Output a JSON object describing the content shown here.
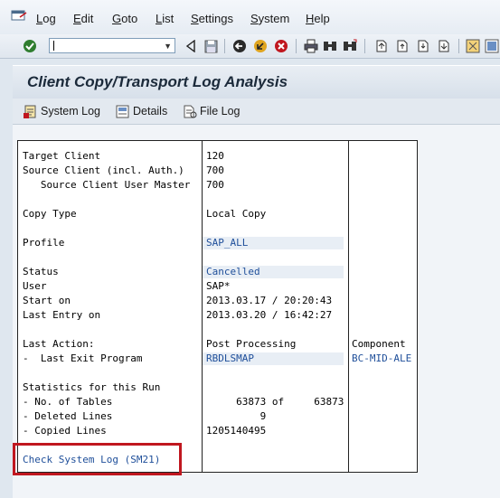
{
  "menu": {
    "items": [
      {
        "label": "Log",
        "underline": "L",
        "rest": "og"
      },
      {
        "label": "Edit",
        "underline": "E",
        "rest": "dit"
      },
      {
        "label": "Goto",
        "underline": "G",
        "rest": "oto"
      },
      {
        "label": "List",
        "underline": "L",
        "rest": "ist"
      },
      {
        "label": "Settings",
        "underline": "S",
        "rest": "ettings"
      },
      {
        "label": "System",
        "underline": "S",
        "rest": "ystem"
      },
      {
        "label": "Help",
        "underline": "H",
        "rest": "elp"
      }
    ]
  },
  "toolbar": {
    "command_field_value": "",
    "icons": [
      "enter-icon",
      "back-icon",
      "save-icon",
      "back-green-icon",
      "exit-icon",
      "cancel-icon",
      "print-icon",
      "find-icon",
      "find-next-icon",
      "first-page-icon",
      "previous-page-icon",
      "next-page-icon",
      "last-page-icon",
      "create-session-icon",
      "help-icon"
    ]
  },
  "title": "Client Copy/Transport Log Analysis",
  "app_toolbar": {
    "system_log": "System Log",
    "details": "Details",
    "file_log": "File Log"
  },
  "report": {
    "rows": [
      {
        "label": "Target Client",
        "value": "120",
        "extra": ""
      },
      {
        "label": "Source Client (incl. Auth.)",
        "value": "700",
        "extra": ""
      },
      {
        "label": "   Source Client User Master",
        "value": "700",
        "extra": ""
      },
      {
        "label": "",
        "value": "",
        "extra": ""
      },
      {
        "label": "Copy Type",
        "value": "Local Copy",
        "extra": ""
      },
      {
        "label": "",
        "value": "",
        "extra": ""
      },
      {
        "label": "Profile",
        "value": "SAP_ALL",
        "extra": ""
      },
      {
        "label": "",
        "value": "",
        "extra": ""
      },
      {
        "label": "Status",
        "value": "Cancelled",
        "extra": ""
      },
      {
        "label": "User",
        "value": "SAP*",
        "extra": ""
      },
      {
        "label": "Start on",
        "value": "2013.03.17 / 20:20:43",
        "extra": ""
      },
      {
        "label": "Last Entry on",
        "value": "2013.03.20 / 16:42:27",
        "extra": ""
      },
      {
        "label": "",
        "value": "",
        "extra": ""
      },
      {
        "label": "Last Action:",
        "value": "Post Processing",
        "extra": "Component"
      },
      {
        "label": "-  Last Exit Program",
        "value": "RBDLSMAP",
        "extra": "BC-MID-ALE"
      },
      {
        "label": "",
        "value": "",
        "extra": ""
      },
      {
        "label": "Statistics for this Run",
        "value": "",
        "extra": ""
      },
      {
        "label": "- No. of Tables",
        "value": "     63873 of     63873",
        "extra": ""
      },
      {
        "label": "- Deleted Lines",
        "value": "         9",
        "extra": ""
      },
      {
        "label": "- Copied Lines",
        "value": "1205140495",
        "extra": ""
      },
      {
        "label": "",
        "value": "",
        "extra": ""
      },
      {
        "label": "Check System Log (SM21)",
        "value": "",
        "extra": ""
      }
    ]
  },
  "colors": {
    "link_blue": "#1f4f9a",
    "highlight_red": "#c0171f"
  }
}
